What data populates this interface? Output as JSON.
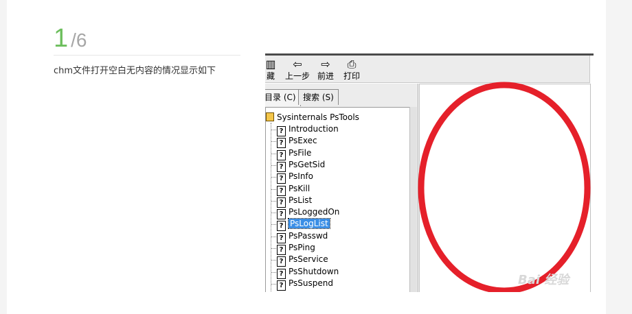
{
  "step": {
    "current": "1",
    "total": "/6"
  },
  "description": "chm文件打开空白无内容的情况显示如下",
  "toolbar": {
    "buttons": [
      {
        "label": "藏",
        "icon": "hide-icon"
      },
      {
        "label": "上一步",
        "icon": "back-arrow-icon"
      },
      {
        "label": "前进",
        "icon": "forward-arrow-icon"
      },
      {
        "label": "打印",
        "icon": "printer-icon"
      }
    ]
  },
  "tabs": [
    {
      "label": "目录 (C)"
    },
    {
      "label": "搜索 (S)"
    }
  ],
  "tree": {
    "root": "Sysinternals PsTools",
    "items": [
      "Introduction",
      "PsExec",
      "PsFile",
      "PsGetSid",
      "PsInfo",
      "PsKill",
      "PsList",
      "PsLoggedOn",
      "PsLogList",
      "PsPasswd",
      "PsPing",
      "PsService",
      "PsShutdown",
      "PsSuspend"
    ],
    "selected_index": 8
  },
  "watermark": "Bai 经验",
  "colors": {
    "accent": "#6cbe5c",
    "highlight": "#3a8ee6",
    "annotation": "#e5202a"
  }
}
